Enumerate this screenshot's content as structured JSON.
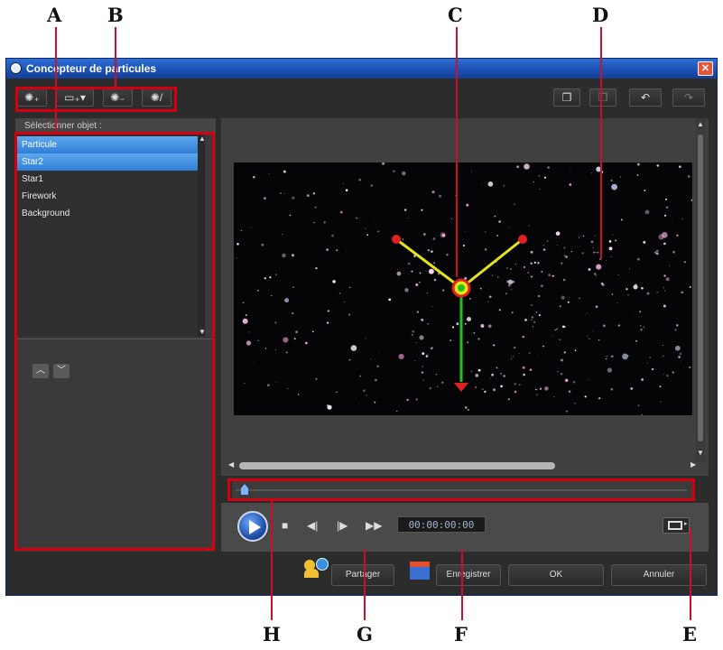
{
  "callouts": {
    "A": "A",
    "B": "B",
    "C": "C",
    "D": "D",
    "E": "E",
    "F": "F",
    "G": "G",
    "H": "H"
  },
  "window": {
    "title": "Concepteur de particules",
    "close_label": "✕"
  },
  "toolbar": {
    "icons": [
      "add-particle-icon",
      "add-image-icon",
      "remove-particle-icon",
      "edit-particle-icon"
    ],
    "right_icons": [
      "copy-icon",
      "paste-icon",
      "undo-icon",
      "redo-icon"
    ]
  },
  "object_panel": {
    "header": "Sélectionner objet :",
    "items": [
      "Particule",
      "Star2",
      "Star1",
      "Firework",
      "Background"
    ],
    "selected": [
      "Particule",
      "Star2"
    ]
  },
  "player": {
    "timecode": "00:00:00:00"
  },
  "buttons": {
    "share": "Partager",
    "save": "Enregistrer",
    "ok": "OK",
    "cancel": "Annuler"
  },
  "colors": {
    "accent": "#2e7fd6",
    "callout_line": "#c8102e",
    "highlight_box": "#d5000f",
    "yellow_handle": "#e5e51a",
    "green_handle": "#22c022",
    "red_handle": "#e02020"
  }
}
